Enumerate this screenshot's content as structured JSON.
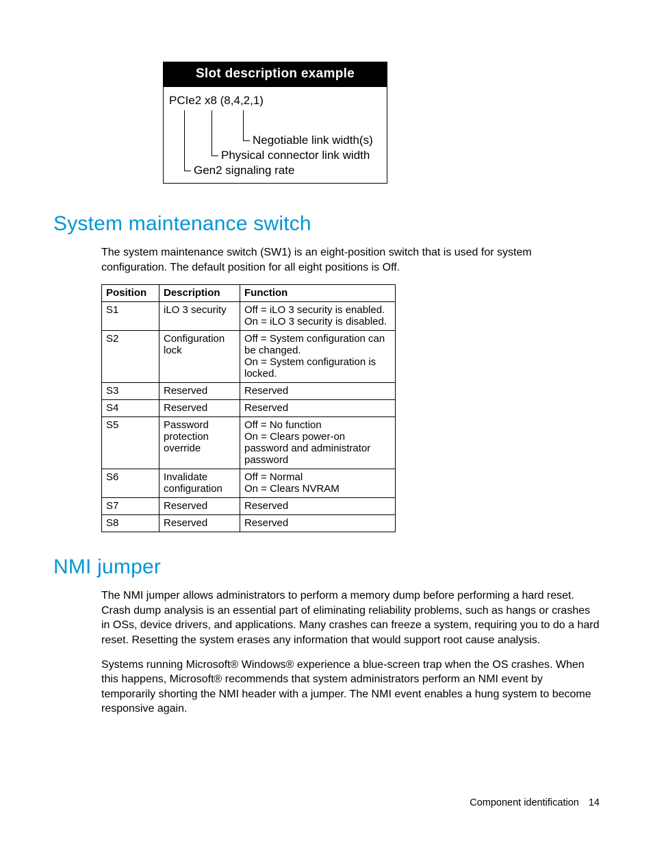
{
  "slot": {
    "header": "Slot description example",
    "main": "PCIe2 x8 (8,4,2,1)",
    "l1": "Negotiable link width(s)",
    "l2": "Physical connector link width",
    "l3": "Gen2 signaling rate"
  },
  "sms": {
    "title": "System maintenance switch",
    "intro": "The system maintenance switch (SW1) is an eight-position switch that is used for system configuration. The default position for all eight positions is Off.",
    "headers": {
      "pos": "Position",
      "desc": "Description",
      "func": "Function"
    },
    "rows": [
      {
        "pos": "S1",
        "desc": "iLO 3 security",
        "func": "Off = iLO 3 security is enabled.\nOn = iLO 3 security is disabled."
      },
      {
        "pos": "S2",
        "desc": "Configuration lock",
        "func": "Off = System configuration can be changed.\nOn = System configuration is locked."
      },
      {
        "pos": "S3",
        "desc": "Reserved",
        "func": "Reserved"
      },
      {
        "pos": "S4",
        "desc": "Reserved",
        "func": "Reserved"
      },
      {
        "pos": "S5",
        "desc": "Password protection override",
        "func": "Off = No function\nOn = Clears power-on password and administrator password"
      },
      {
        "pos": "S6",
        "desc": "Invalidate configuration",
        "func": "Off = Normal\nOn = Clears NVRAM"
      },
      {
        "pos": "S7",
        "desc": "Reserved",
        "func": "Reserved"
      },
      {
        "pos": "S8",
        "desc": "Reserved",
        "func": "Reserved"
      }
    ]
  },
  "nmi": {
    "title": "NMI jumper",
    "p1": "The NMI jumper allows administrators to perform a memory dump before performing a hard reset. Crash dump analysis is an essential part of eliminating reliability problems, such as hangs or crashes in OSs, device drivers, and applications. Many crashes can freeze a system, requiring you to do a hard reset. Resetting the system erases any information that would support root cause analysis.",
    "p2": "Systems running Microsoft® Windows® experience a blue-screen trap when the OS crashes. When this happens, Microsoft® recommends that system administrators perform an NMI event by temporarily shorting the NMI header with a jumper. The NMI event enables a hung system to become responsive again."
  },
  "footer": {
    "section": "Component identification",
    "page": "14"
  }
}
